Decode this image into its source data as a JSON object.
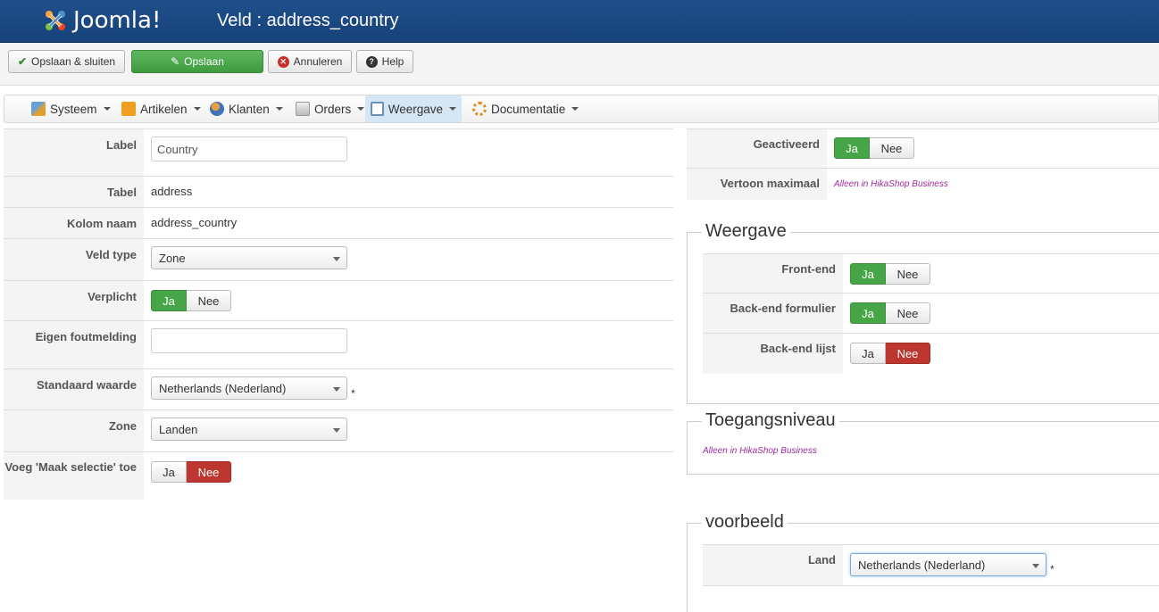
{
  "header": {
    "logo_text": "Joomla!",
    "title": "Veld : address_country"
  },
  "toolbar": {
    "save_close": "Opslaan & sluiten",
    "save": "Opslaan",
    "cancel": "Annuleren",
    "help": "Help"
  },
  "menu": {
    "items": [
      {
        "label": "Systeem"
      },
      {
        "label": "Artikelen"
      },
      {
        "label": "Klanten"
      },
      {
        "label": "Orders"
      },
      {
        "label": "Weergave"
      },
      {
        "label": "Documentatie"
      }
    ]
  },
  "form": {
    "label": {
      "label": "Label",
      "value": "Country"
    },
    "table": {
      "label": "Tabel",
      "value": "address"
    },
    "column": {
      "label": "Kolom naam",
      "value": "address_country"
    },
    "type": {
      "label": "Veld type",
      "value": "Zone"
    },
    "required": {
      "label": "Verplicht",
      "yes": "Ja",
      "no": "Nee",
      "selected": "Ja"
    },
    "error": {
      "label": "Eigen foutmelding",
      "value": ""
    },
    "default": {
      "label": "Standaard waarde",
      "value": "Netherlands (Nederland)",
      "asterisk": "*"
    },
    "zone": {
      "label": "Zone",
      "value": "Landen"
    },
    "add_select": {
      "label": "Voeg 'Maak selectie' toe",
      "yes": "Ja",
      "no": "Nee",
      "selected": "Nee"
    }
  },
  "right": {
    "activated": {
      "label": "Geactiveerd",
      "yes": "Ja",
      "no": "Nee",
      "selected": "Ja"
    },
    "max_display": {
      "label": "Vertoon maximaal",
      "note": "Alleen in HikaShop Business"
    },
    "display": {
      "legend": "Weergave",
      "frontend": {
        "label": "Front-end",
        "yes": "Ja",
        "no": "Nee",
        "selected": "Ja"
      },
      "backend_form": {
        "label": "Back-end formulier",
        "yes": "Ja",
        "no": "Nee",
        "selected": "Ja"
      },
      "backend_list": {
        "label": "Back-end lijst",
        "yes": "Ja",
        "no": "Nee",
        "selected": "Nee"
      }
    },
    "access": {
      "legend": "Toegangsniveau",
      "note": "Alleen in HikaShop Business"
    },
    "example": {
      "legend": "voorbeeld",
      "label": "Land",
      "value": "Netherlands (Nederland)",
      "asterisk": "*"
    }
  },
  "colors": {
    "header_bg": "#1f4f8a",
    "green": "#46a546",
    "red": "#bd362f",
    "note": "#9c2a9c"
  }
}
